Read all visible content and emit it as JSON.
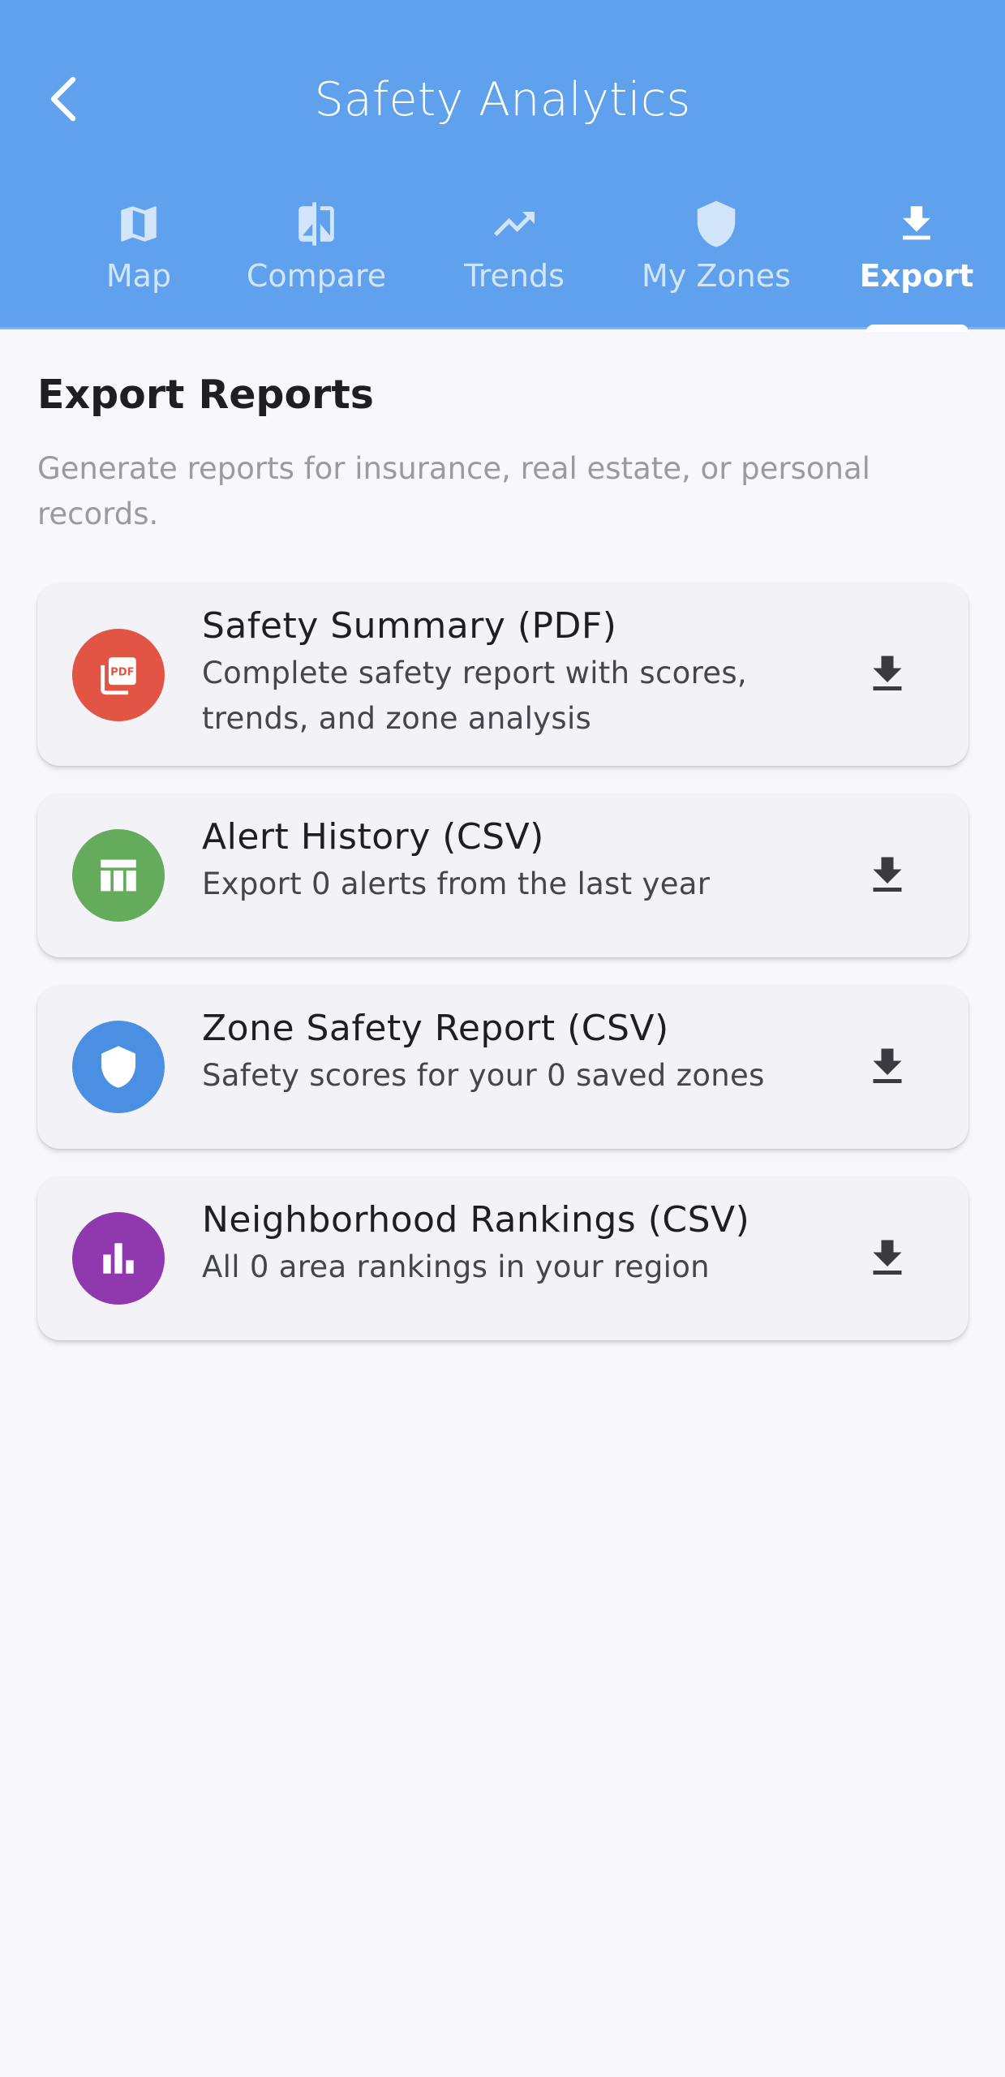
{
  "header": {
    "title": "Safety Analytics",
    "background": "#5FA1EC"
  },
  "tabs": [
    {
      "label": "Map",
      "icon": "map-icon",
      "active": false
    },
    {
      "label": "Compare",
      "icon": "compare-icon",
      "active": false
    },
    {
      "label": "Trends",
      "icon": "trending-up-icon",
      "active": false
    },
    {
      "label": "My Zones",
      "icon": "shield-icon",
      "active": false
    },
    {
      "label": "Export",
      "icon": "download-icon",
      "active": true
    }
  ],
  "content": {
    "title": "Export Reports",
    "subtitle": "Generate reports for insurance, real estate, or personal records."
  },
  "reports": [
    {
      "title": "Safety Summary (PDF)",
      "description": "Complete safety report with scores, trends, and zone analysis",
      "icon": "pdf-icon",
      "color": "#E25443"
    },
    {
      "title": "Alert History (CSV)",
      "description": "Export 0 alerts from the last year",
      "icon": "table-icon",
      "color": "#64AB5B"
    },
    {
      "title": "Zone Safety Report (CSV)",
      "description": "Safety scores for your 0 saved zones",
      "icon": "shield-icon",
      "color": "#4B8FE3"
    },
    {
      "title": "Neighborhood Rankings (CSV)",
      "description": "All 0 area rankings in your region",
      "icon": "bar-chart-icon",
      "color": "#9038AE"
    }
  ]
}
